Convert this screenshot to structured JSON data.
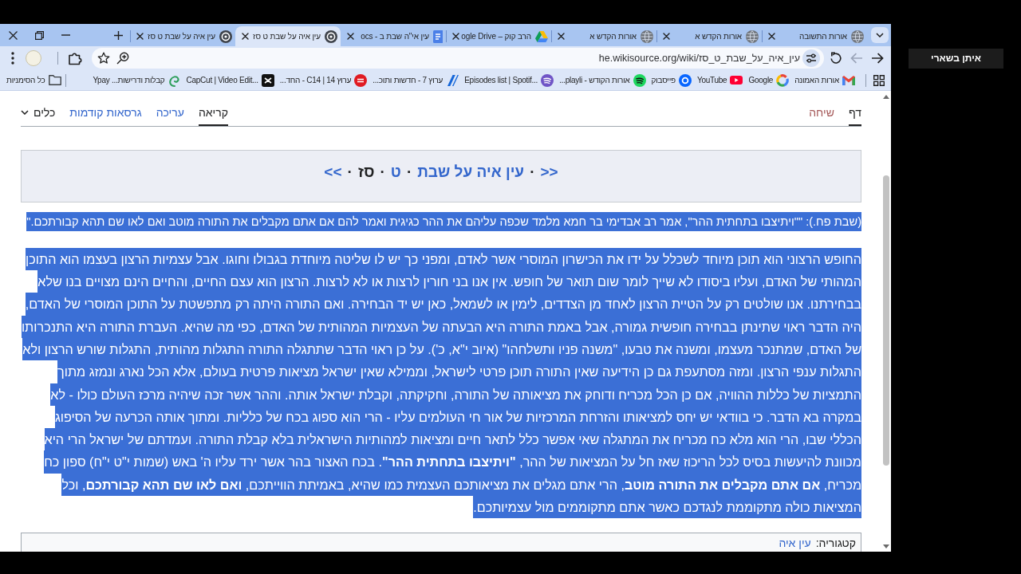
{
  "browser": {
    "tabs": [
      {
        "title": "אורות התשובה",
        "selected": false
      },
      {
        "title": "אורות הקדש א",
        "selected": false
      },
      {
        "title": "אורות הקדש א",
        "selected": false
      },
      {
        "title": "הרב קוק – ogle Drive",
        "selected": false
      },
      {
        "title": "עין אי\"ה שבת ב - ocs",
        "selected": false
      },
      {
        "title": "עין איה על שבת ט סז",
        "selected": true
      },
      {
        "title": "עין איה על שבת ט סז",
        "selected": false
      }
    ],
    "toolbar": {
      "back": {
        "disabled": false
      },
      "forward": {
        "disabled": true
      },
      "url": "he.wikisource.org/wiki/עין_איה_על_שבת_ט_סז"
    },
    "bookmarks": [
      "אורות האמונה",
      "Google",
      "YouTube",
      "פייסבוק",
      "אורות הקודש - playli...",
      "Episodes list | Spotif...",
      "ערוץ 7 - חדשות ותוכ...",
      "ערוץ 14 | C14 - החד...",
      "CapCut | Video Edit...",
      "קבלות ודרישות... Ypay"
    ],
    "all_bookmarks": "כל הסימניות"
  },
  "page": {
    "tabs_right": [
      {
        "label": "דף",
        "selected": true,
        "missing": false
      },
      {
        "label": "שיחה",
        "selected": false,
        "missing": true
      }
    ],
    "tabs_left": [
      {
        "label": "קריאה",
        "selected": true,
        "kind": "tab"
      },
      {
        "label": "עריכה",
        "selected": false,
        "kind": "tab"
      },
      {
        "label": "גרסאות קודמות",
        "selected": false,
        "kind": "tab"
      },
      {
        "label": "כלים",
        "selected": false,
        "kind": "menu"
      }
    ],
    "navigation": [
      {
        "text": ">>",
        "kind": "link"
      },
      {
        "text": "·",
        "kind": "separator"
      },
      {
        "text": "עין איה על שבת",
        "kind": "link"
      },
      {
        "text": "·",
        "kind": "separator"
      },
      {
        "text": "ט",
        "kind": "link"
      },
      {
        "text": "·",
        "kind": "separator"
      },
      {
        "text": "סז",
        "kind": "current"
      },
      {
        "text": "·",
        "kind": "separator"
      },
      {
        "text": "<<",
        "kind": "link"
      }
    ],
    "quote": {
      "text": "(שבת פח.): \"\"ויתיצבו בתחתית ההר\", אמר רב אבדימי בר חמא מלמד שכפה עליהם את ההר כגיגית ואמר להם אם אתם מקבלים את התורה מוטב ואם לאו שם תהא קבורתכם.\"",
      "selected": true
    },
    "paragraph": {
      "text": "החופש הרצוני הוא תוכן מיוחד לשכלל על ידו את הכישרון המוסרי אשר לאדם, ומפני כך יש לו שליטה מיוחדת בגבולו וחוגו. אבל עצמיות הרצון בעצמו הוא התוכן המהותי של האדם, ועליו ביסודו לא שייך לומר שום תואר של חופש. אין אנו בני חורין לרצות או לא לרצות. הרצון הוא עצם החיים, והחיים הינם מצויים בנו שלא בבחירתנו. אנו שולטים רק על הטיית הרצון לאחד מן הצדדים, לימין או לשמאל, כאן יש יד הבחירה. ואם התורה היתה רק מתפשטת על התוכן המוסרי של האדם, היה הדבר ראוי שתינתן בבחירה חופשית גמורה, אבל באמת התורה היא הבעתה של העצמיות המהותית של האדם, כפי מה שהיא. העברת התורה היא התנכרותו של האדם, שמתנכר מעצמו, ומשנה את טבעו, \"משנה פניו ותשלחהו\" (איוב י\"א, כ'). על כן ראוי הדבר שתתגלה התורה התגלות מהותית, התגלות שורש הרצון ולא התגלות ענפי הרצון. ומזה מסתעפת גם כן הידיעה שאין התורה תוכן פרטי לישראל, וממילא שאין ישראל מציאות פרטית בעולם, אלא הכל נארג ונמזג מתוך התמציות של כללות ההוויה, אם כן הכל מכריח ודוחק את מציאותה של התורה, וחקיקתה, וקבלת ישראל אותה. וההר אשר זכה שיהיה מרכז העולם כולו - לא במקרה בא הדבר. כי בוודאי יש יחס למציאותו והזרחת המרכזיות של אור חי העולמים עליו - הרי הוא ספוג בכח של כלליות. ומתוך אותה הכרעה של הסיפוג הכללי שבו, הרי הוא מלא כח מכריח את המתגלה שאי אפשר כלל לתאר חיים ומציאות למהותיות הישראלית בלא קבלת התורה. ועמדתם של ישראל הרי היא מכוונת להיעשות בסיס לכל הריכוז שאז חל על המציאות של ההר, **\"ויתיצבו בתחתית ההר\"**. בכח האצור בהר אשר ירד עליו ה' באש (שמות י\"ט י\"ח) ספון כח מכריח, **אם אתם מקבלים את התורה מוטב**, הרי אתם מגלים את מציאותכם העצמית כמו שהיא, באמיתת הווייתכם, **ואם לאו שם תהא קבורתכם**, וכל המציאות כולה מתקוממת לנגדכם כאשר אתם מתקוממים מול עצמיותכם.",
      "selected": true
    },
    "categories": {
      "label": "קטגוריה:",
      "links": [
        "עין איה"
      ]
    }
  },
  "side_panel": {
    "name": "איתן בשארי"
  }
}
